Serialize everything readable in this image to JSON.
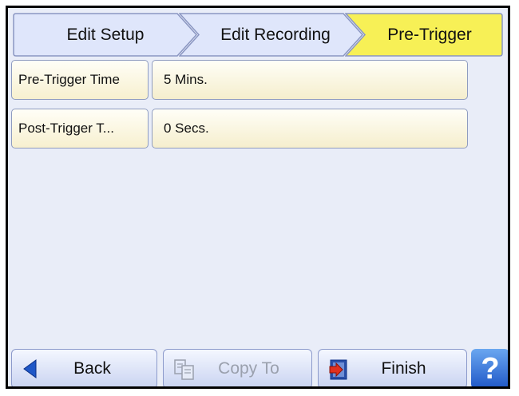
{
  "breadcrumb": {
    "tabs": [
      {
        "label": "Edit Setup",
        "state": "inactive"
      },
      {
        "label": "Edit Recording",
        "state": "inactive"
      },
      {
        "label": "Pre-Trigger",
        "state": "active"
      }
    ],
    "colors": {
      "inactive": "#dfe6fb",
      "active": "#f7f056",
      "border": "#8a96c2"
    }
  },
  "fields": [
    {
      "label": "Pre-Trigger Time",
      "value": "5 Mins."
    },
    {
      "label": "Post-Trigger T...",
      "value": "0 Secs."
    }
  ],
  "footer": {
    "back_label": "Back",
    "copy_label": "Copy To",
    "copy_disabled": true,
    "finish_label": "Finish",
    "help_glyph": "?"
  },
  "icons": {
    "back": "left-arrow-icon",
    "copy": "copy-icon",
    "finish": "exit-door-icon",
    "help": "question-mark-icon"
  },
  "colors": {
    "panel_background": "#e9edf8",
    "field_fill": "#f7f0cf",
    "button_fill": "#c9d3f1",
    "help_button": "#2a65d4"
  }
}
